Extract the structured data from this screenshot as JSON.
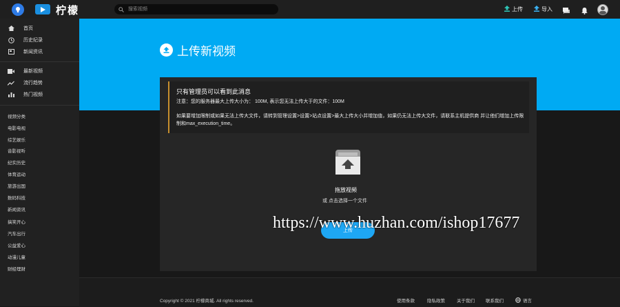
{
  "brand": {
    "name": "柠檬"
  },
  "search": {
    "placeholder": "搜索视频"
  },
  "header": {
    "upload_label": "上传",
    "import_label": "导入"
  },
  "sidebar": {
    "nav": [
      {
        "label": "首页",
        "icon": "home-icon"
      },
      {
        "label": "历史纪录",
        "icon": "history-icon"
      },
      {
        "label": "新闻资讯",
        "icon": "news-icon"
      }
    ],
    "nav2": [
      {
        "label": "最新视频",
        "icon": "video-icon"
      },
      {
        "label": "流行趋势",
        "icon": "trending-icon"
      },
      {
        "label": "热门视频",
        "icon": "chart-icon"
      }
    ],
    "categories": [
      "视频分类",
      "电影电视",
      "综艺娱乐",
      "音影视听",
      "纪实历史",
      "体育运动",
      "旅游出国",
      "数码科技",
      "新闻资讯",
      "搞笑开心",
      "汽车出行",
      "公益爱心",
      "动漫儿童",
      "财经理财"
    ]
  },
  "hero": {
    "title": "上传新视频"
  },
  "notice": {
    "title": "只有管理员可以看到此消息",
    "limit": "注意：您的服务器最大上传大小为： 100M, 表示您无法上传大于的文件：100M",
    "help": "如果要增加限制或如果无法上传大文件，请转到管理设置>设置>站点设置>最大上传大小并增加值，如果仍无法上传大文件，请联系主机提供商 并让他们增加上传限制和max_execution_time。"
  },
  "dropzone": {
    "title": "拖放视频",
    "subtitle": "或 点击选择一个文件",
    "button": "上传"
  },
  "watermark": "https://www.huzhan.com/ishop17677",
  "footer": {
    "copyright": "Copyright © 2021 柠檬商城. All rights reserved.",
    "links": [
      "使用条款",
      "隐私政策",
      "关于我们",
      "联系我们"
    ],
    "language": "语言"
  }
}
